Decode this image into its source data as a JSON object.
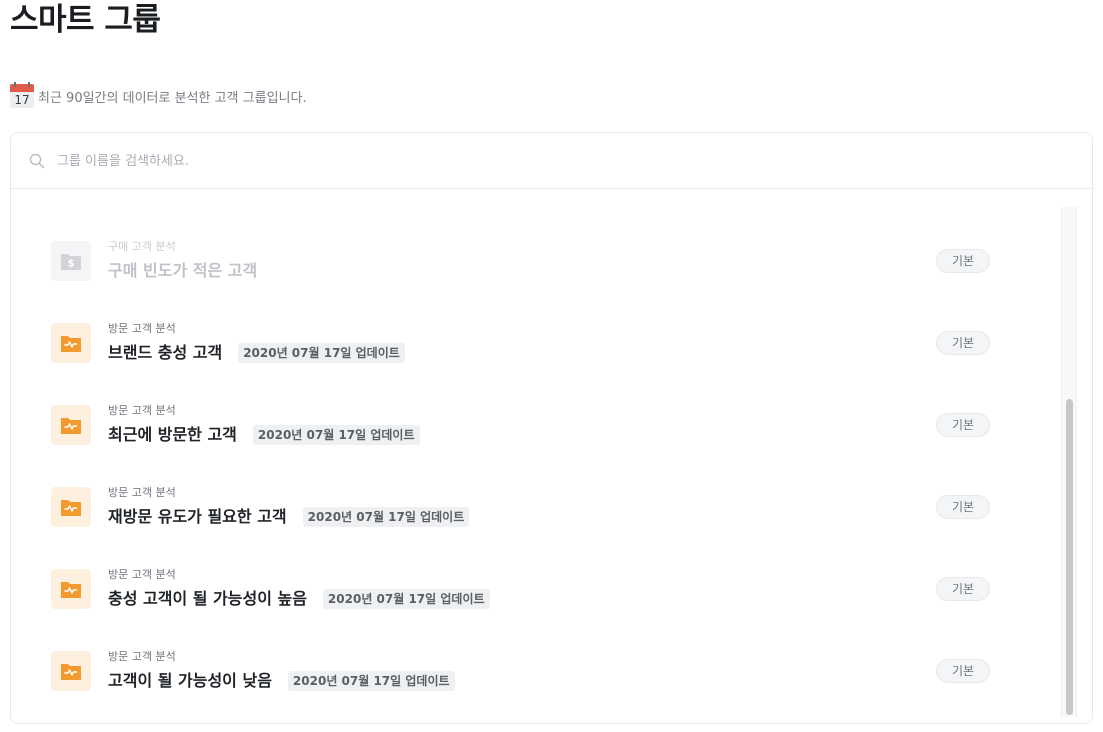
{
  "page": {
    "title": "스마트 그룹",
    "subtitle": "최근 90일간의 데이터로 분석한 고객 그룹입니다.",
    "calendar_day": "17"
  },
  "search": {
    "placeholder": "그룹 이름을 검색하세요."
  },
  "colors": {
    "accent_orange": "#f29a2e",
    "icon_bg": "#fdf0de",
    "tag_bg": "#eef0f2"
  },
  "groups": [
    {
      "category": "구매 고객 분석",
      "name": "구매 빈도가 적은 고객",
      "updated": "",
      "badge": "기본",
      "icon": "dollar-folder-icon",
      "dimmed": true
    },
    {
      "category": "방문 고객 분석",
      "name": "브랜드 충성 고객",
      "updated": "2020년 07월 17일 업데이트",
      "badge": "기본",
      "icon": "activity-folder-icon",
      "dimmed": false
    },
    {
      "category": "방문 고객 분석",
      "name": "최근에 방문한 고객",
      "updated": "2020년 07월 17일 업데이트",
      "badge": "기본",
      "icon": "activity-folder-icon",
      "dimmed": false
    },
    {
      "category": "방문 고객 분석",
      "name": "재방문 유도가 필요한 고객",
      "updated": "2020년 07월 17일 업데이트",
      "badge": "기본",
      "icon": "activity-folder-icon",
      "dimmed": false
    },
    {
      "category": "방문 고객 분석",
      "name": "충성 고객이 될 가능성이 높음",
      "updated": "2020년 07월 17일 업데이트",
      "badge": "기본",
      "icon": "activity-folder-icon",
      "dimmed": false
    },
    {
      "category": "방문 고객 분석",
      "name": "고객이 될 가능성이 낮음",
      "updated": "2020년 07월 17일 업데이트",
      "badge": "기본",
      "icon": "activity-folder-icon",
      "dimmed": false
    }
  ]
}
